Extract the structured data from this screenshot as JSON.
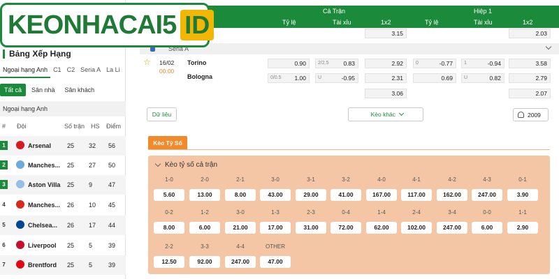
{
  "logo": {
    "text": "KEONHACAI5",
    "suffix": "ID"
  },
  "standings": {
    "title": "Bảng Xếp Hạng",
    "league_tabs": [
      "Ngoại hạng Anh",
      "C1",
      "C2",
      "Seria A",
      "La Li"
    ],
    "filters": [
      "Tất cả",
      "Sân nhà",
      "Sân khách"
    ],
    "league_name": "Ngoại hạng Anh",
    "columns": {
      "rank": "#",
      "team": "Đội",
      "played": "Số trận",
      "hs": "HS",
      "points": "Điểm"
    },
    "rows": [
      {
        "pos": "1",
        "team": "Arsenal",
        "played": "25",
        "hs": "32",
        "points": "56",
        "crest": "#d71920"
      },
      {
        "pos": "2",
        "team": "Manches...",
        "played": "25",
        "hs": "27",
        "points": "50",
        "crest": "#6cabdd"
      },
      {
        "pos": "3",
        "team": "Aston Villa",
        "played": "25",
        "hs": "9",
        "points": "47",
        "crest": "#95bfe5"
      },
      {
        "pos": "4",
        "team": "Manches...",
        "played": "26",
        "hs": "10",
        "points": "45",
        "crest": "#da291c"
      },
      {
        "pos": "5",
        "team": "Chelsea...",
        "played": "26",
        "hs": "17",
        "points": "44",
        "crest": "#034694"
      },
      {
        "pos": "6",
        "team": "Liverpool",
        "played": "25",
        "hs": "5",
        "points": "39",
        "crest": "#c8102e"
      },
      {
        "pos": "7",
        "team": "Brentford",
        "played": "25",
        "hs": "5",
        "points": "39",
        "crest": "#e30613"
      }
    ]
  },
  "odds": {
    "header": {
      "full_match": "Cả Trận",
      "first_half": "Hiệp 1"
    },
    "subheader": {
      "ty_le": "Tỷ lệ",
      "tai_xiu": "Tài xỉu",
      "x12": "1x2"
    },
    "top_row": {
      "full_1x2": "3.15",
      "half_1x2": "2.03"
    },
    "league": "Seria A",
    "match": {
      "date": "16/02",
      "time": "00:00",
      "home": "Torino",
      "away": "Bologna",
      "row1": {
        "hc": "0.90",
        "ou_line": "2/2.5",
        "ou": "0.83",
        "x12": "2.92",
        "h_hc_line": "0",
        "h_hc": "-0.77",
        "h_ou_line": "1",
        "h_ou": "-0.94",
        "h_x12": "3.58"
      },
      "row2": {
        "hc_line": "0/0.5",
        "hc": "1.00",
        "ou_line": "U",
        "ou": "-0.95",
        "x12": "2.31",
        "h_hc": "0.69",
        "h_ou_line": "U",
        "h_ou": "0.82",
        "h_x12": "2.79"
      },
      "row3": {
        "x12": "3.06",
        "h_x12": "2.07"
      }
    },
    "buttons": {
      "data": "Dữ liệu",
      "more": "Kèo khác",
      "count": "2009"
    }
  },
  "score_section": {
    "tab": "Kèo Tỷ Số",
    "title": "Kèo tỷ số cả trận",
    "rows": [
      [
        {
          "label": "1-0",
          "odds": "5.60"
        },
        {
          "label": "2-0",
          "odds": "13.00"
        },
        {
          "label": "2-1",
          "odds": "8.00"
        },
        {
          "label": "3-0",
          "odds": "43.00"
        },
        {
          "label": "3-1",
          "odds": "29.00"
        },
        {
          "label": "3-2",
          "odds": "41.00"
        },
        {
          "label": "4-0",
          "odds": "167.00"
        },
        {
          "label": "4-1",
          "odds": "117.00"
        },
        {
          "label": "4-2",
          "odds": "162.00"
        },
        {
          "label": "4-3",
          "odds": "247.00"
        },
        {
          "label": "0-1",
          "odds": "3.90"
        }
      ],
      [
        {
          "label": "0-2",
          "odds": "8.00"
        },
        {
          "label": "1-2",
          "odds": "6.00"
        },
        {
          "label": "3-0",
          "odds": "21.00"
        },
        {
          "label": "1-3",
          "odds": "17.00"
        },
        {
          "label": "2-3",
          "odds": "31.00"
        },
        {
          "label": "0-4",
          "odds": "72.00"
        },
        {
          "label": "1-4",
          "odds": "62.00"
        },
        {
          "label": "2-4",
          "odds": "102.00"
        },
        {
          "label": "3-4",
          "odds": "247.00"
        },
        {
          "label": "0-0",
          "odds": "6.00"
        },
        {
          "label": "1-1",
          "odds": "2.90"
        }
      ],
      [
        {
          "label": "2-2",
          "odds": "12.50"
        },
        {
          "label": "3-3",
          "odds": "92.00"
        },
        {
          "label": "4-4",
          "odds": "247.00"
        },
        {
          "label": "OTHER",
          "odds": "47.00"
        }
      ]
    ]
  }
}
